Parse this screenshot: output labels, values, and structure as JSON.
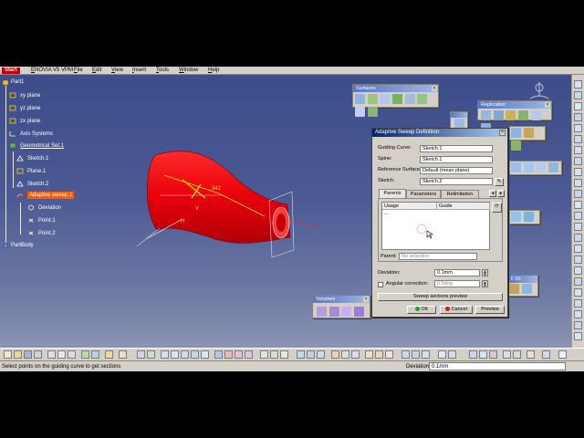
{
  "menu": {
    "start": "Start",
    "items": [
      "ENOVIA V5 VPM",
      "File",
      "Edit",
      "View",
      "Insert",
      "Tools",
      "Window",
      "Help"
    ]
  },
  "tree": {
    "root": "Part1",
    "nodes": [
      "xy plane",
      "yz plane",
      "zx plane",
      "Axis Systems",
      "Geometrical Set.1",
      "Sketch.1",
      "Plane.1",
      "Sketch.2",
      "Adaptive sweep.1",
      "Deviation",
      "Point.1",
      "Point.2",
      "PartBody"
    ]
  },
  "toolbars": {
    "surfaces": "Surfaces",
    "replication": "Replication",
    "volumes": "Volumes",
    "analysis_fragment": "ll Sh"
  },
  "dialog": {
    "title": "Adaptive Sweep Definition",
    "guiding_curve_label": "Guiding Curve:",
    "guiding_curve_value": "Sketch.1",
    "spine_label": "Spine:",
    "spine_value": "Sketch.1",
    "reference_surface_label": "Reference Surface:",
    "reference_surface_value": "Default (mean plane)",
    "sketch_label": "Sketch:",
    "sketch_value": "Sketch.2",
    "tabs": [
      "Parents",
      "Parameters",
      "Relimitation"
    ],
    "list_headers": [
      "Usage",
      "Guide"
    ],
    "list_row": "...",
    "parent_label": "Parent:",
    "parent_value": "No selection",
    "deviation_label": "Deviation:",
    "deviation_value": "0.1mm",
    "angular_label": "Angular correction:",
    "angular_value": "0.5deg",
    "sweep_preview": "Sweep sections preview",
    "ok": "OK",
    "cancel": "Cancel",
    "preview": "Preview"
  },
  "model": {
    "dimension": "342",
    "label_h": "H",
    "label_v": "V"
  },
  "status": {
    "message": "Select points on the guiding curve to get sections",
    "deviation_label": "Deviation",
    "deviation_value": "0.1mm"
  },
  "colors": {
    "surface": "#e8000a",
    "selected_tree": "#ff5a00",
    "background_top": "#3d4d8a",
    "background_bottom": "#8a93b2"
  }
}
